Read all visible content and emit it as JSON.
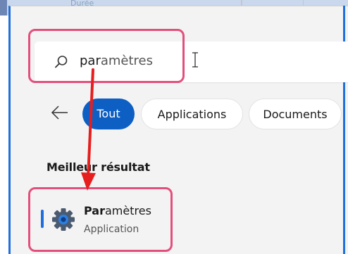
{
  "background_window": {
    "faint_text": "Durée"
  },
  "search": {
    "typed_prefix": "par",
    "autocomplete_rest": "amètres",
    "icon": "search-icon"
  },
  "filters": {
    "back_icon": "arrow-left-icon",
    "tabs": [
      {
        "label": "Tout",
        "active": true
      },
      {
        "label": "Applications",
        "active": false
      },
      {
        "label": "Documents",
        "active": false
      }
    ]
  },
  "best_match": {
    "heading": "Meilleur résultat",
    "title_bold": "Par",
    "title_rest": "amètres",
    "subtitle": "Application",
    "icon": "gear-icon"
  },
  "colors": {
    "accent": "#0d5fc4",
    "highlight": "#e34f7b",
    "annotation_arrow": "#e61e1e"
  }
}
